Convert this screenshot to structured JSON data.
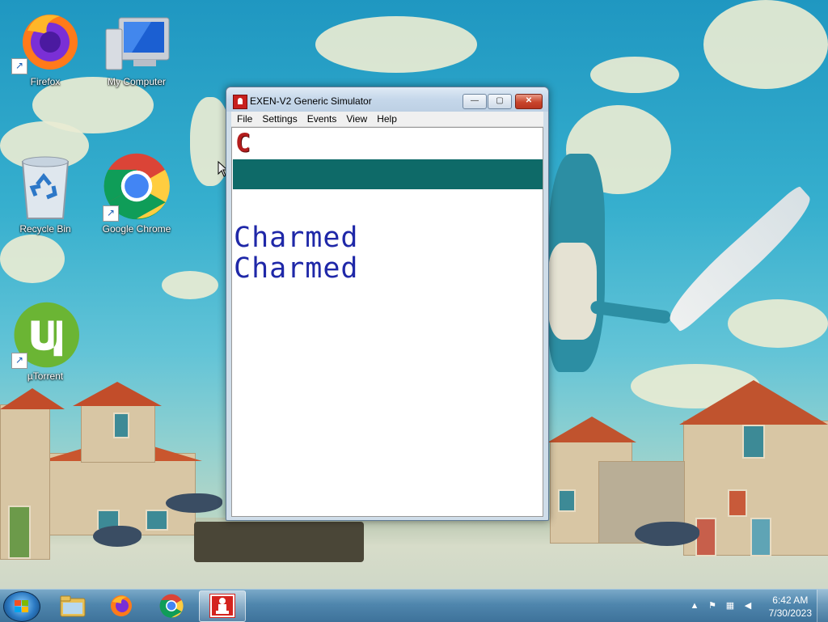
{
  "desktop": {
    "icons": [
      {
        "label": "Firefox"
      },
      {
        "label": "My Computer"
      },
      {
        "label": "Recycle Bin"
      },
      {
        "label": "Google Chrome"
      },
      {
        "label": "µTorrent"
      }
    ]
  },
  "window": {
    "title": "EXEN-V2 Generic Simulator",
    "buttons": {
      "minimize": "—",
      "maximize": "▢",
      "close": "✕"
    },
    "menu": [
      "File",
      "Settings",
      "Events",
      "View",
      "Help"
    ],
    "content": {
      "glyph": "C",
      "lines": [
        "Charmed",
        "Charmed"
      ]
    }
  },
  "taskbar": {
    "clock_time": "6:42 AM",
    "clock_date": "7/30/2023",
    "tray_icons": [
      "show-hidden-icons-arrow",
      "action-center-icon",
      "network-icon",
      "volume-icon"
    ]
  },
  "colors": {
    "teal_bar": "#0e6a68",
    "glyph_red": "#b31d1d",
    "text_blue": "#1f28a8"
  }
}
